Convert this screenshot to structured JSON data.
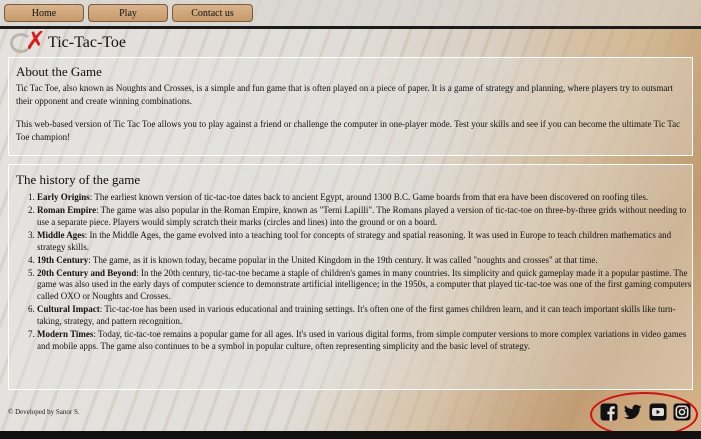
{
  "nav": {
    "home": "Home",
    "play": "Play",
    "contact": "Contact us"
  },
  "header": {
    "title": "Tic-Tac-Toe",
    "logo_icons": [
      "o-mark-icon",
      "x-mark-icon"
    ]
  },
  "about": {
    "heading": "About the Game",
    "p1": "Tic Tac Toe, also known as Noughts and Crosses, is a simple and fun game that is often played on a piece of paper. It is a game of strategy and planning, where players try to outsmart their opponent and create winning combinations.",
    "p2": "This web-based version of Tic Tac Toe allows you to play against a friend or challenge the computer in one-player mode. Test your skills and see if you can become the ultimate Tic Tac Toe champion!"
  },
  "history": {
    "heading": "The history of the game",
    "items": [
      {
        "title": "Early Origins",
        "text": ": The earliest known version of tic-tac-toe dates back to ancient Egypt, around 1300 B.C. Game boards from that era have been discovered on roofing tiles."
      },
      {
        "title": "Roman Empire",
        "text": ": The game was also popular in the Roman Empire, known as \"Terni Lapilli\". The Romans played a version of tic-tac-toe on three-by-three grids without needing to use a separate piece. Players would simply scratch their marks (circles and lines) into the ground or on a board."
      },
      {
        "title": "Middle Ages",
        "text": ": In the Middle Ages, the game evolved into a teaching tool for concepts of strategy and spatial reasoning. It was used in Europe to teach children mathematics and strategy skills."
      },
      {
        "title": "19th Century",
        "text": ": The game, as it is known today, became popular in the United Kingdom in the 19th century. It was called \"noughts and crosses\" at that time."
      },
      {
        "title": "20th Century and Beyond",
        "text": ": In the 20th century, tic-tac-toe became a staple of children's games in many countries. Its simplicity and quick gameplay made it a popular pastime. The game was also used in the early days of computer science to demonstrate artificial intelligence; in the 1950s, a computer that played tic-tac-toe was one of the first gaming computers called OXO or Noughts and Crosses."
      },
      {
        "title": "Cultural Impact",
        "text": ": Tic-tac-toe has been used in various educational and training settings. It's often one of the first games children learn, and it can teach important skills like turn-taking, strategy, and pattern recognition."
      },
      {
        "title": "Modern Times",
        "text": ": Today, tic-tac-toe remains a popular game for all ages. It's used in various digital forms, from simple computer versions to more complex variations in video games and mobile apps. The game also continues to be a symbol in popular culture, often representing simplicity and the basic level of strategy."
      }
    ]
  },
  "footer": {
    "credit": "© Developed by Sanor S.",
    "social_icons": [
      "facebook-icon",
      "twitter-icon",
      "youtube-icon",
      "instagram-icon"
    ],
    "highlight_color": "#d90f0f"
  },
  "colors": {
    "nav_button": "#c69a6c",
    "logo_x": "#e01818",
    "bottom_bar": "#111111"
  }
}
